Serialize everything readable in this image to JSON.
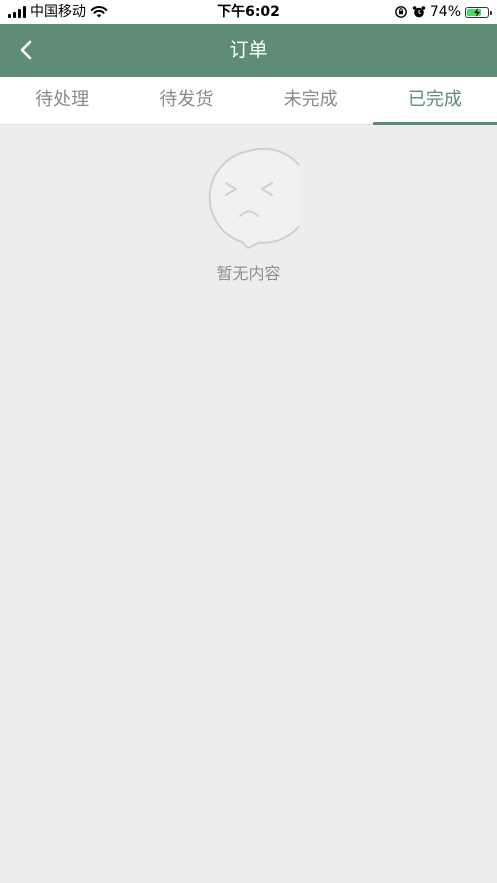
{
  "status_bar": {
    "carrier": "中国移动",
    "time": "下午6:02",
    "battery_percent": "74%",
    "battery_level": 0.74,
    "icons": [
      "signal-icon",
      "wifi-icon",
      "orientation-lock-icon",
      "alarm-icon",
      "battery-icon"
    ]
  },
  "nav": {
    "title": "订单",
    "back_icon": "chevron-left-icon"
  },
  "tabs": [
    {
      "label": "待处理",
      "active": false
    },
    {
      "label": "待发货",
      "active": false
    },
    {
      "label": "未完成",
      "active": false
    },
    {
      "label": "已完成",
      "active": true
    }
  ],
  "empty_state": {
    "icon": "sad-face-bubble-icon",
    "text": "暂无内容"
  },
  "colors": {
    "nav_background": "#5f8c75",
    "accent": "#5f8c75",
    "page_background": "#ededed",
    "tab_inactive_text": "#8a8a8a",
    "empty_text": "#8f8f8f"
  }
}
